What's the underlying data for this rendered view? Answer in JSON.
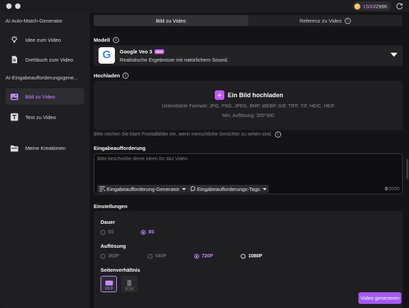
{
  "titlebar": {
    "credits_current": "1500",
    "credits_total": "/2996"
  },
  "sidebar": {
    "group1_title": "AI Auto-Match-Generator",
    "items_group1": [
      {
        "label": "Idee zum Video",
        "icon": "lightbulb-icon"
      },
      {
        "label": "Drehbuch zum Video",
        "icon": "document-icon"
      }
    ],
    "group2_title": "AI-Eingabeaufforderungsgene...",
    "items_group2": [
      {
        "label": "Bild zu Video",
        "icon": "image-icon",
        "active": true
      },
      {
        "label": "Text zu Video",
        "icon": "text-icon"
      }
    ],
    "my_creations": {
      "label": "Meine Kreationen",
      "icon": "folder-icon"
    }
  },
  "tabs": [
    {
      "label": "Bild zu Video",
      "active": true
    },
    {
      "label": "Referenz zu Video",
      "active": false
    }
  ],
  "model": {
    "section_label": "Modell",
    "name": "Google Veo 3",
    "badge": "NEW",
    "description": "Realistische Ergebnisse mit natürlichem Sound.",
    "logo_letter": "G"
  },
  "upload": {
    "section_label": "Hochladen",
    "button_label": "Ein Bild hochladen",
    "formats": "Unterstützte Formate: JPG, PNG, JPEG, BMP, WEBP, GIF, TIFF, TIF, HEIC, HEIF",
    "min_resolution": "Min. Auflösung: 300*300",
    "hint": "Bitte reichen Sie klare Frontalbilder ein, wenn menschliche Gesichter zu sehen sind."
  },
  "prompt": {
    "section_label": "Eingabeaufforderung",
    "placeholder": "Bitte beschreibe deine Ideen für das Video.",
    "generator_label": "Eingabeaufforderung-Generator",
    "tags_label": "Eingabeaufforderungs-Tags",
    "count": "0",
    "max": "/2000"
  },
  "settings": {
    "section_label": "Einstellungen",
    "duration": {
      "label": "Dauer",
      "options": [
        "5S",
        "8S"
      ],
      "selected": "8S"
    },
    "resolution": {
      "label": "Auflösung",
      "options": [
        "360P",
        "540P",
        "720P",
        "1080P"
      ],
      "selected": "720P"
    },
    "aspect": {
      "label": "Seitenverhältnis",
      "options": [
        "16:9",
        "9:16"
      ],
      "selected": "16:9"
    }
  },
  "generate_label": "Video generieren",
  "colors": {
    "accent": "#c58bff",
    "button": "#a35af0",
    "background": "#141416",
    "sidebar": "#1f1f22"
  }
}
